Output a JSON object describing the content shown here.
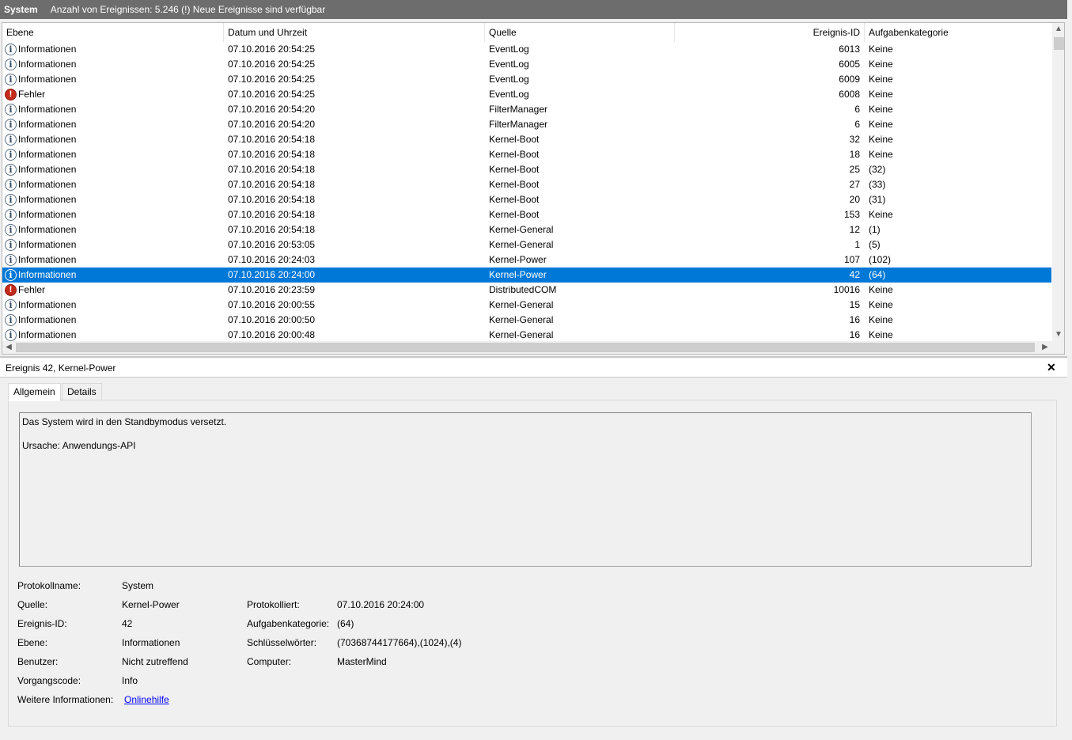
{
  "titlebar": {
    "title": "System",
    "status": "Anzahl von Ereignissen: 5.246 (!) Neue Ereignisse sind verfügbar"
  },
  "columns": [
    "Ebene",
    "Datum und Uhrzeit",
    "Quelle",
    "Ereignis-ID",
    "Aufgabenkategorie"
  ],
  "events": [
    {
      "level": "Informationen",
      "icon": "info-icon",
      "date": "07.10.2016 20:54:25",
      "source": "EventLog",
      "id": "6013",
      "category": "Keine"
    },
    {
      "level": "Informationen",
      "icon": "info-icon",
      "date": "07.10.2016 20:54:25",
      "source": "EventLog",
      "id": "6005",
      "category": "Keine"
    },
    {
      "level": "Informationen",
      "icon": "info-icon",
      "date": "07.10.2016 20:54:25",
      "source": "EventLog",
      "id": "6009",
      "category": "Keine"
    },
    {
      "level": "Fehler",
      "icon": "error-icon",
      "date": "07.10.2016 20:54:25",
      "source": "EventLog",
      "id": "6008",
      "category": "Keine"
    },
    {
      "level": "Informationen",
      "icon": "info-icon",
      "date": "07.10.2016 20:54:20",
      "source": "FilterManager",
      "id": "6",
      "category": "Keine"
    },
    {
      "level": "Informationen",
      "icon": "info-icon",
      "date": "07.10.2016 20:54:20",
      "source": "FilterManager",
      "id": "6",
      "category": "Keine"
    },
    {
      "level": "Informationen",
      "icon": "info-icon",
      "date": "07.10.2016 20:54:18",
      "source": "Kernel-Boot",
      "id": "32",
      "category": "Keine"
    },
    {
      "level": "Informationen",
      "icon": "info-icon",
      "date": "07.10.2016 20:54:18",
      "source": "Kernel-Boot",
      "id": "18",
      "category": "Keine"
    },
    {
      "level": "Informationen",
      "icon": "info-icon",
      "date": "07.10.2016 20:54:18",
      "source": "Kernel-Boot",
      "id": "25",
      "category": "(32)"
    },
    {
      "level": "Informationen",
      "icon": "info-icon",
      "date": "07.10.2016 20:54:18",
      "source": "Kernel-Boot",
      "id": "27",
      "category": "(33)"
    },
    {
      "level": "Informationen",
      "icon": "info-icon",
      "date": "07.10.2016 20:54:18",
      "source": "Kernel-Boot",
      "id": "20",
      "category": "(31)"
    },
    {
      "level": "Informationen",
      "icon": "info-icon",
      "date": "07.10.2016 20:54:18",
      "source": "Kernel-Boot",
      "id": "153",
      "category": "Keine"
    },
    {
      "level": "Informationen",
      "icon": "info-icon",
      "date": "07.10.2016 20:54:18",
      "source": "Kernel-General",
      "id": "12",
      "category": "(1)"
    },
    {
      "level": "Informationen",
      "icon": "info-icon",
      "date": "07.10.2016 20:53:05",
      "source": "Kernel-General",
      "id": "1",
      "category": "(5)"
    },
    {
      "level": "Informationen",
      "icon": "info-icon",
      "date": "07.10.2016 20:24:03",
      "source": "Kernel-Power",
      "id": "107",
      "category": "(102)"
    },
    {
      "level": "Informationen",
      "icon": "info-icon",
      "date": "07.10.2016 20:24:00",
      "source": "Kernel-Power",
      "id": "42",
      "category": "(64)",
      "selected": true
    },
    {
      "level": "Fehler",
      "icon": "error-icon",
      "date": "07.10.2016 20:23:59",
      "source": "DistributedCOM",
      "id": "10016",
      "category": "Keine"
    },
    {
      "level": "Informationen",
      "icon": "info-icon",
      "date": "07.10.2016 20:00:55",
      "source": "Kernel-General",
      "id": "15",
      "category": "Keine"
    },
    {
      "level": "Informationen",
      "icon": "info-icon",
      "date": "07.10.2016 20:00:50",
      "source": "Kernel-General",
      "id": "16",
      "category": "Keine"
    },
    {
      "level": "Informationen",
      "icon": "info-icon",
      "date": "07.10.2016 20:00:48",
      "source": "Kernel-General",
      "id": "16",
      "category": "Keine"
    }
  ],
  "detail": {
    "title": "Ereignis 42, Kernel-Power",
    "close": "✕",
    "tabs": [
      "Allgemein",
      "Details"
    ],
    "description_line1": "Das System wird in den Standbymodus versetzt.",
    "description_line2": "Ursache: Anwendungs-API",
    "fields": {
      "protokollname_label": "Protokollname:",
      "protokollname": "System",
      "quelle_label": "Quelle:",
      "quelle": "Kernel-Power",
      "protokolliert_label": "Protokolliert:",
      "protokolliert": "07.10.2016 20:24:00",
      "ereignisid_label": "Ereignis-ID:",
      "ereignisid": "42",
      "aufgabenkategorie_label": "Aufgabenkategorie:",
      "aufgabenkategorie": "(64)",
      "ebene_label": "Ebene:",
      "ebene": "Informationen",
      "schluesselwoerter_label": "Schlüsselwörter:",
      "schluesselwoerter": "(70368744177664),(1024),(4)",
      "benutzer_label": "Benutzer:",
      "benutzer": "Nicht zutreffend",
      "computer_label": "Computer:",
      "computer": "MasterMind",
      "vorgangscode_label": "Vorgangscode:",
      "vorgangscode": "Info",
      "weitere_label": "Weitere Informationen:",
      "weitere_link": "Onlinehilfe"
    }
  }
}
